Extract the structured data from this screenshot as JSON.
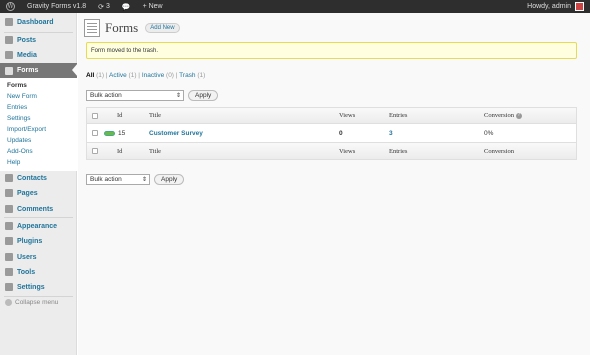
{
  "adminbar": {
    "site_name": "Gravity Forms v1.8",
    "updates_count": "3",
    "new_label": "New",
    "howdy": "Howdy, admin"
  },
  "sidebar": {
    "items": [
      {
        "label": "Dashboard",
        "icon": "dashboard-icon"
      },
      {
        "label": "Posts",
        "icon": "pin-icon"
      },
      {
        "label": "Media",
        "icon": "media-icon"
      },
      {
        "label": "Forms",
        "icon": "forms-icon"
      },
      {
        "label": "Contacts",
        "icon": "contacts-icon"
      },
      {
        "label": "Pages",
        "icon": "pages-icon"
      },
      {
        "label": "Comments",
        "icon": "comments-icon"
      },
      {
        "label": "Appearance",
        "icon": "appearance-icon"
      },
      {
        "label": "Plugins",
        "icon": "plugins-icon"
      },
      {
        "label": "Users",
        "icon": "users-icon"
      },
      {
        "label": "Tools",
        "icon": "tools-icon"
      },
      {
        "label": "Settings",
        "icon": "settings-icon"
      }
    ],
    "submenu": [
      "Forms",
      "New Form",
      "Entries",
      "Settings",
      "Import/Export",
      "Updates",
      "Add-Ons",
      "Help"
    ],
    "collapse_label": "Collapse menu"
  },
  "main": {
    "title": "Forms",
    "add_new": "Add New",
    "notice": "Form moved to the trash.",
    "filters": [
      {
        "label": "All",
        "count": "(1)"
      },
      {
        "label": "Active",
        "count": "(1)"
      },
      {
        "label": "Inactive",
        "count": "(0)"
      },
      {
        "label": "Trash",
        "count": "(1)"
      }
    ],
    "bulk_action": "Bulk action",
    "apply": "Apply",
    "columns": {
      "id": "Id",
      "title": "Title",
      "views": "Views",
      "entries": "Entries",
      "conversion": "Conversion"
    },
    "rows": [
      {
        "id": "15",
        "title": "Customer Survey",
        "views": "0",
        "entries": "3",
        "conversion": "0%",
        "active": true
      }
    ]
  },
  "colors": {
    "link": "#21759b",
    "notice_bg": "#ffffe0",
    "active_toggle": "#6cb94a"
  }
}
